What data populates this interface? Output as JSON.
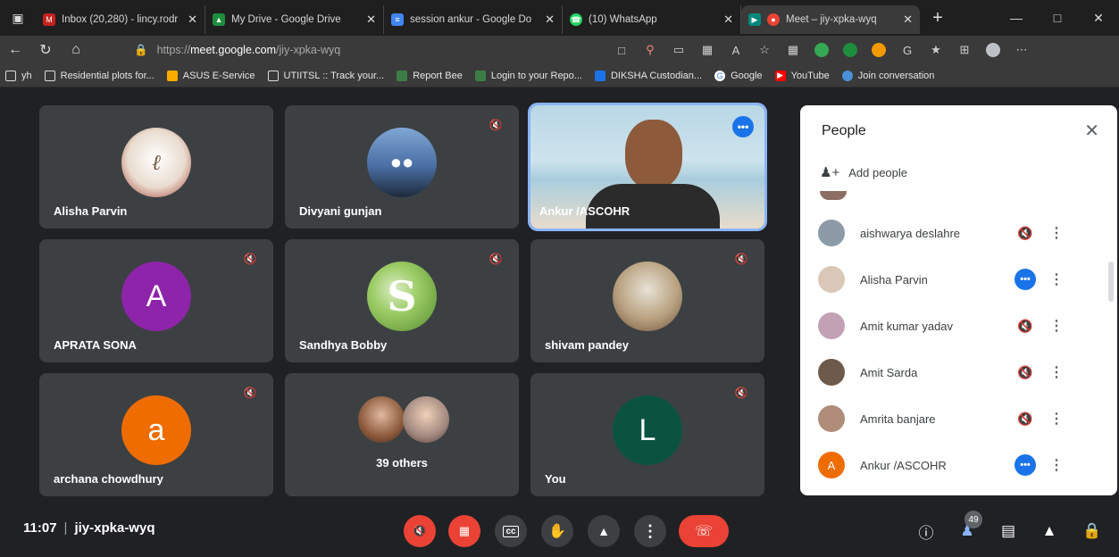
{
  "browser": {
    "tabs": [
      {
        "title": "Inbox (20,280) - lincy.rodr",
        "icon": "gmail-icon",
        "color": "#c5221f"
      },
      {
        "title": "My Drive - Google Drive",
        "icon": "drive-icon",
        "color": "#1e8e3e"
      },
      {
        "title": "session ankur - Google Do",
        "icon": "docs-icon",
        "color": "#4285f4"
      },
      {
        "title": "(10) WhatsApp",
        "icon": "whatsapp-icon",
        "color": "#25d366"
      },
      {
        "title": "Meet – jiy-xpka-wyq",
        "icon": "meet-icon",
        "color": "#00897b"
      }
    ],
    "url_prefix": "https://",
    "url_host": "meet.google.com",
    "url_path": "/jiy-xpka-wyq",
    "bookmarks": [
      "yh",
      "Residential plots for...",
      "ASUS E-Service",
      "UTIITSL :: Track your...",
      "Report Bee",
      "Login to your Repo...",
      "DIKSHA Custodian...",
      "Google",
      "YouTube",
      "Join conversation"
    ]
  },
  "tiles": [
    {
      "name": "Alisha Parvin",
      "muted": false,
      "avatar_type": "photo",
      "avatar_color": "#e9dccf"
    },
    {
      "name": "Divyani gunjan",
      "muted": true,
      "avatar_type": "photo",
      "avatar_color": "#4a6fa5"
    },
    {
      "name": "Ankur /ASCOHR",
      "muted": false,
      "avatar_type": "video",
      "avatar_color": "#b9d7e6"
    },
    {
      "name": "APRATA SONA",
      "muted": true,
      "avatar_type": "letter",
      "letter": "A",
      "avatar_color": "#8e24aa"
    },
    {
      "name": "Sandhya Bobby",
      "muted": true,
      "avatar_type": "logo",
      "avatar_color": "#7cb342"
    },
    {
      "name": "shivam pandey",
      "muted": true,
      "avatar_type": "photo",
      "avatar_color": "#b8a17f"
    },
    {
      "name": "archana chowdhury",
      "muted": true,
      "avatar_type": "letter",
      "letter": "a",
      "avatar_color": "#ef6c00"
    },
    {
      "name": "39 others",
      "muted": false,
      "avatar_type": "group",
      "avatar_color": "#a1887f"
    },
    {
      "name": "You",
      "muted": true,
      "avatar_type": "letter",
      "letter": "L",
      "avatar_color": "#0b5341"
    }
  ],
  "panel": {
    "title": "People",
    "add_people": "Add people",
    "people": [
      {
        "name": "aishwarya deslahre",
        "muted": true,
        "avatar_color": "#8d9aa8"
      },
      {
        "name": "Alisha Parvin",
        "muted": false,
        "avatar_color": "#d9c7b7"
      },
      {
        "name": "Amit kumar yadav",
        "muted": true,
        "avatar_color": "#c2a1b5"
      },
      {
        "name": "Amit Sarda",
        "muted": true,
        "avatar_color": "#6d5a4a"
      },
      {
        "name": "Amrita banjare",
        "muted": true,
        "avatar_color": "#b08c7a"
      },
      {
        "name": "Ankur /ASCOHR",
        "muted": false,
        "letter": "A",
        "avatar_color": "#ef6c00"
      }
    ]
  },
  "bottom": {
    "time": "11:07",
    "meeting_code": "jiy-xpka-wyq",
    "participant_count": "49"
  }
}
